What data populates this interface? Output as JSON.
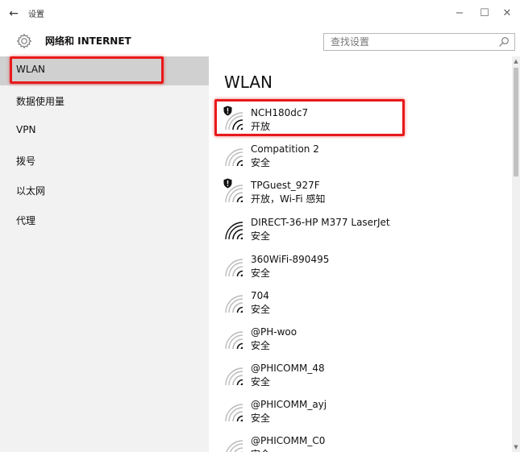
{
  "window": {
    "back_icon": "←",
    "title": "设置",
    "minimize_icon": "−",
    "maximize_icon": "☐",
    "close_icon": "✕"
  },
  "header": {
    "title": "网络和 INTERNET",
    "gear_icon": "gear-icon",
    "search_placeholder": "查找设置",
    "search_value": ""
  },
  "sidebar": {
    "items": [
      {
        "label": "WLAN",
        "selected": true
      },
      {
        "label": "数据使用量",
        "selected": false
      },
      {
        "label": "VPN",
        "selected": false
      },
      {
        "label": "拨号",
        "selected": false
      },
      {
        "label": "以太网",
        "selected": false
      },
      {
        "label": "代理",
        "selected": false
      }
    ]
  },
  "main": {
    "title": "WLAN",
    "networks": [
      {
        "name": "NCH180dc7",
        "status": "开放",
        "shield": true,
        "strong": false
      },
      {
        "name": "Compatition 2",
        "status": "安全",
        "shield": false,
        "strong": false
      },
      {
        "name": "TPGuest_927F",
        "status": "开放，Wi-Fi 感知",
        "shield": true,
        "strong": false
      },
      {
        "name": "DIRECT-36-HP M377 LaserJet",
        "status": "安全",
        "shield": false,
        "strong": true
      },
      {
        "name": "360WiFi-890495",
        "status": "安全",
        "shield": false,
        "strong": false
      },
      {
        "name": "704",
        "status": "安全",
        "shield": false,
        "strong": false
      },
      {
        "name": "@PH-woo",
        "status": "安全",
        "shield": false,
        "strong": false
      },
      {
        "name": "@PHICOMM_48",
        "status": "安全",
        "shield": false,
        "strong": false
      },
      {
        "name": "@PHICOMM_ayj",
        "status": "安全",
        "shield": false,
        "strong": false
      },
      {
        "name": "@PHICOMM_C0",
        "status": "安全",
        "shield": false,
        "strong": false
      }
    ]
  },
  "colors": {
    "highlight_border": "#e8191b",
    "sidebar_bg": "#f2f2f2",
    "sidebar_selected": "#d0d0d0"
  }
}
